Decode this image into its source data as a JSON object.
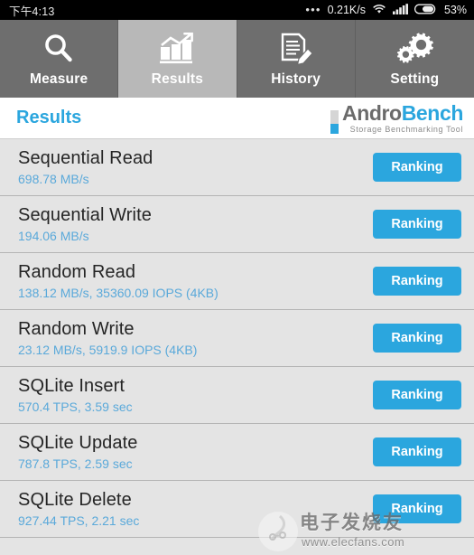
{
  "statusbar": {
    "time": "下午4:13",
    "dots": "•••",
    "net_speed": "0.21K/s",
    "wifi_icon": "wifi-icon",
    "signal_icon": "signal-icon",
    "battery_icon": "battery-icon",
    "battery_percent": "53%"
  },
  "tabs": [
    {
      "label": "Measure",
      "icon": "magnifier-icon",
      "active": false
    },
    {
      "label": "Results",
      "icon": "bar-chart-icon",
      "active": true
    },
    {
      "label": "History",
      "icon": "document-pencil-icon",
      "active": false
    },
    {
      "label": "Setting",
      "icon": "gears-icon",
      "active": false
    }
  ],
  "header": {
    "title": "Results",
    "logo_primary": "Andro",
    "logo_secondary": "Bench",
    "logo_subtitle": "Storage Benchmarking Tool"
  },
  "list": {
    "button_label": "Ranking",
    "rows": [
      {
        "title": "Sequential Read",
        "value": "698.78 MB/s"
      },
      {
        "title": "Sequential Write",
        "value": "194.06 MB/s"
      },
      {
        "title": "Random Read",
        "value": "138.12 MB/s, 35360.09 IOPS (4KB)"
      },
      {
        "title": "Random Write",
        "value": "23.12 MB/s, 5919.9 IOPS (4KB)"
      },
      {
        "title": "SQLite Insert",
        "value": "570.4 TPS, 3.59 sec"
      },
      {
        "title": "SQLite Update",
        "value": "787.8 TPS, 2.59 sec"
      },
      {
        "title": "SQLite Delete",
        "value": "927.44 TPS, 2.21 sec"
      }
    ]
  },
  "watermark": {
    "text_cn": "电子发烧友",
    "url": "www.elecfans.com"
  },
  "colors": {
    "accent_blue": "#2ba6de",
    "value_blue": "#5aa9da",
    "tab_inactive": "#6e6e6e",
    "tab_active": "#b8b8b8",
    "row_bg": "#e4e4e4"
  }
}
